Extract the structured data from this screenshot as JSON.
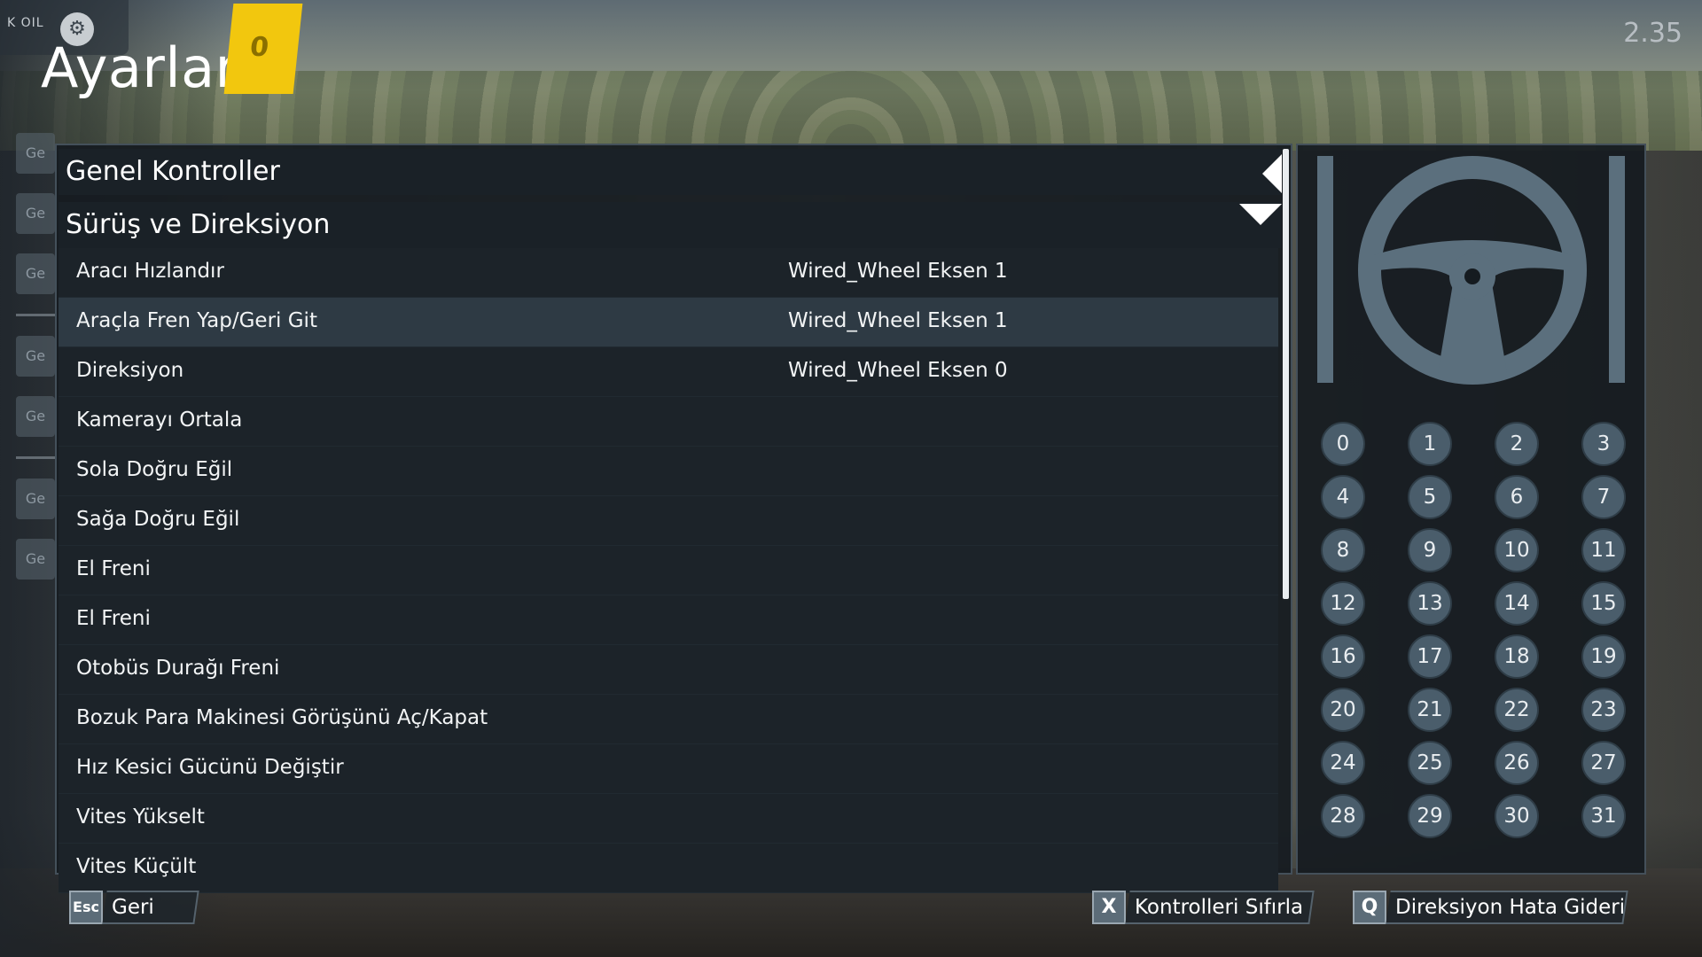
{
  "header": {
    "badge_text": "K OIL",
    "badge_icon": "gear-icon",
    "title": "Ayarlar",
    "tag_text": "0",
    "version": "2.35"
  },
  "side_tabs": [
    "Ge",
    "Ge",
    "Ge",
    "Ge",
    "Ge",
    "Ge",
    "Ge"
  ],
  "sections": {
    "general": "Genel Kontroller",
    "driving": "Sürüş ve Direksiyon"
  },
  "rows": [
    {
      "name": "Aracı Hızlandır",
      "binding": "Wired_Wheel Eksen 1"
    },
    {
      "name": "Araçla Fren Yap/Geri Git",
      "binding": "Wired_Wheel Eksen 1"
    },
    {
      "name": "Direksiyon",
      "binding": "Wired_Wheel Eksen 0"
    },
    {
      "name": "Kamerayı Ortala",
      "binding": ""
    },
    {
      "name": "Sola Doğru Eğil",
      "binding": ""
    },
    {
      "name": "Sağa Doğru Eğil",
      "binding": ""
    },
    {
      "name": "El Freni",
      "binding": ""
    },
    {
      "name": "El Freni",
      "binding": ""
    },
    {
      "name": "Otobüs Durağı Freni",
      "binding": ""
    },
    {
      "name": "Bozuk Para Makinesi Görüşünü Aç/Kapat",
      "binding": ""
    },
    {
      "name": "Hız Kesici Gücünü Değiştir",
      "binding": ""
    },
    {
      "name": "Vites Yükselt",
      "binding": ""
    },
    {
      "name": "Vites Küçült",
      "binding": ""
    }
  ],
  "highlighted_row": 1,
  "wheel_buttons": [
    "0",
    "1",
    "2",
    "3",
    "4",
    "5",
    "6",
    "7",
    "8",
    "9",
    "10",
    "11",
    "12",
    "13",
    "14",
    "15",
    "16",
    "17",
    "18",
    "19",
    "20",
    "21",
    "22",
    "23",
    "24",
    "25",
    "26",
    "27",
    "28",
    "29",
    "30",
    "31"
  ],
  "footer": {
    "back_key": "Esc",
    "back_label": "Geri",
    "reset_key": "X",
    "reset_label": "Kontrolleri Sıfırla",
    "debug_key": "Q",
    "debug_label": "Direksiyon Hata Gideric"
  },
  "colors": {
    "accent_yellow": "#f2c70e",
    "panel_bg": "#151b20",
    "highlight_row": "#2e3a44",
    "wheel_icon": "#5b6f7d"
  }
}
